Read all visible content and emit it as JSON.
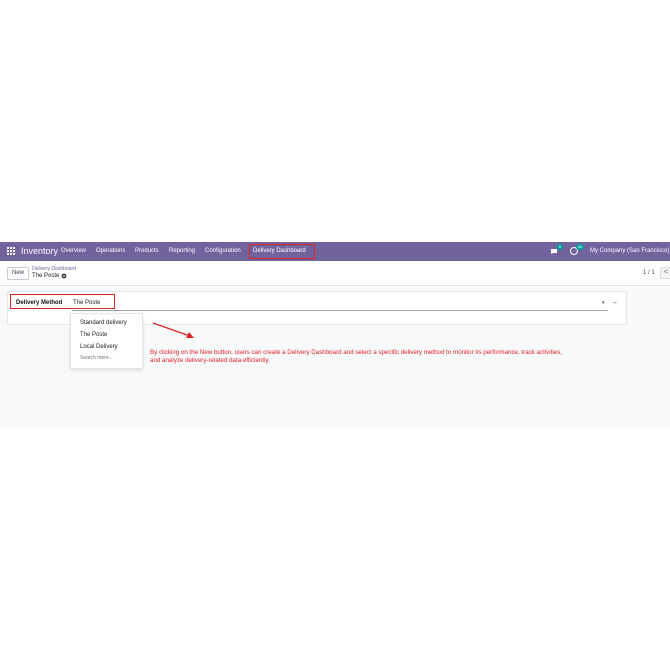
{
  "navbar": {
    "app_name": "Inventory",
    "menu": [
      "Overview",
      "Operations",
      "Products",
      "Reporting",
      "Configuration",
      "Delivery Dashboard"
    ],
    "active_menu": "Delivery Dashboard",
    "chat_badge": "6",
    "activity_badge": "44",
    "company": "My Company (San Francisco)"
  },
  "control_panel": {
    "new_label": "New",
    "breadcrumb_parent": "Delivery Dashboard",
    "breadcrumb_current": "The Poste",
    "pager": "1 / 1",
    "prev_symbol": "<"
  },
  "form": {
    "field_label": "Delivery Method",
    "field_value": "The Poste",
    "caret_symbol": "▾",
    "link_symbol": "→"
  },
  "dropdown": {
    "options": [
      "Standard delivery",
      "The Poste",
      "Local Delivery"
    ],
    "search_more": "Search more..."
  },
  "annotation": {
    "text": "By clicking on the New button, users can create a Delivery Dashboard and select a specific delivery method to monitor its performance, track activities, and analyze delivery-related data efficiently.",
    "color": "#e02424"
  },
  "colors": {
    "navbar": "#71639e",
    "accent": "#71639e",
    "badge": "#00a09d",
    "highlight": "#e02424"
  }
}
